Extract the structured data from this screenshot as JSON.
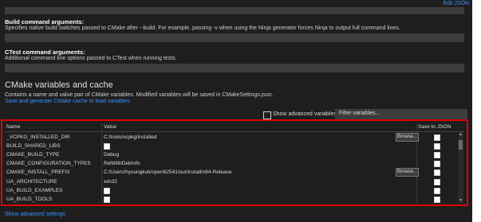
{
  "top_link": "Edit JSON",
  "build_args": {
    "title": "Build command arguments:",
    "description": "Specifies native build switches passed to CMake after --build. For example, passing -v when using the Ninja generator forces Ninja to output full command lines.",
    "value": ""
  },
  "ctest_args": {
    "title": "CTest command arguments:",
    "description": "Additional command line options passed to CTest when running tests.",
    "value": ""
  },
  "cmake_vars": {
    "title": "CMake variables and cache",
    "description": "Contains a name and value pair of CMake variables. Modified variables will be saved in CMakeSettings.json.",
    "save_link": "Save and generate CMake cache to load variables",
    "show_advanced_label": "Show advanced variables",
    "show_advanced_checked": false,
    "filter_placeholder": "Filter variables...",
    "columns": {
      "name": "Name",
      "value": "Value",
      "save": "Save to JSON"
    },
    "browse_label": "Browse...",
    "rows": [
      {
        "name": "_VCPKG_INSTALLED_DIR",
        "value": "C:/tools/vcpkg/installed",
        "type": "path",
        "save": false
      },
      {
        "name": "BUILD_SHARED_LIBS",
        "value": "",
        "type": "bool",
        "save": false
      },
      {
        "name": "CMAKE_BUILD_TYPE",
        "value": "Debug",
        "type": "text",
        "save": false
      },
      {
        "name": "CMAKE_CONFIGURATION_TYPES",
        "value": "RelWithDebInfo",
        "type": "text",
        "save": false
      },
      {
        "name": "CMAKE_INSTALL_PREFIX",
        "value": "C:/Users/hyoungkuk/open62541/out/install/x64-Release",
        "type": "path",
        "save": false
      },
      {
        "name": "UA_ARCHITECTURE",
        "value": "win32",
        "type": "text",
        "save": false
      },
      {
        "name": "UA_BUILD_EXAMPLES",
        "value": "",
        "type": "bool",
        "save": false
      },
      {
        "name": "UA_BUILD_TOOLS",
        "value": "",
        "type": "bool",
        "save": false
      }
    ]
  },
  "bottom_link": "Show advanced settings",
  "colors": {
    "accent_link": "#3794ff",
    "highlight_frame": "#e00000",
    "background": "#1e1e1e"
  }
}
